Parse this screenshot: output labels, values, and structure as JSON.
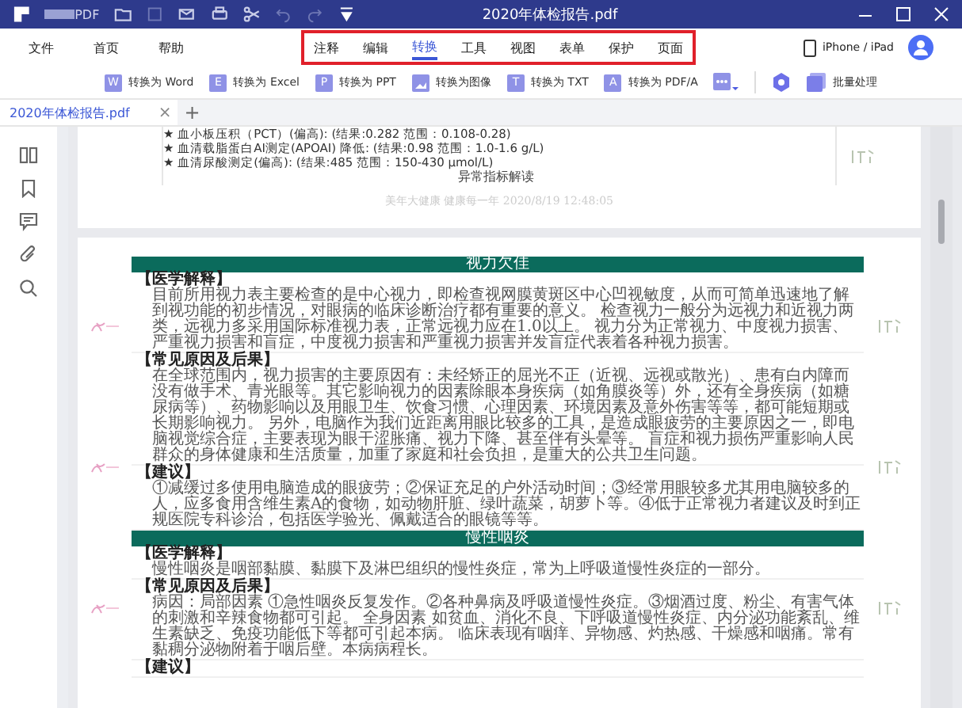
{
  "title_bar": {
    "app_name": "PDF",
    "title": "2020年体检报告.pdf"
  },
  "menu": {
    "items": [
      "文件",
      "首页",
      "帮助"
    ],
    "tabs": [
      {
        "label": "注释",
        "selected": false
      },
      {
        "label": "编辑",
        "selected": false
      },
      {
        "label": "转换",
        "selected": true
      },
      {
        "label": "工具",
        "selected": false
      },
      {
        "label": "视图",
        "selected": false
      },
      {
        "label": "表单",
        "selected": false
      },
      {
        "label": "保护",
        "selected": false
      },
      {
        "label": "页面",
        "selected": false
      }
    ],
    "device": "iPhone / iPad"
  },
  "toolbar": [
    {
      "kind": "convert",
      "icon_letter": "W",
      "label": "转换为 Word"
    },
    {
      "kind": "convert",
      "icon_letter": "E",
      "label": "转换为 Excel"
    },
    {
      "kind": "convert",
      "icon_letter": "P",
      "label": "转换为 PPT"
    },
    {
      "kind": "image",
      "label": "转换为图像"
    },
    {
      "kind": "convert",
      "icon_letter": "T",
      "label": "转换为 TXT"
    },
    {
      "kind": "convert",
      "icon_letter": "A",
      "label": "转换为 PDF/A"
    },
    {
      "kind": "more"
    },
    {
      "kind": "divider"
    },
    {
      "kind": "settings"
    },
    {
      "kind": "batch",
      "label": "批量处理"
    }
  ],
  "doc_tabs": [
    {
      "label": "2020年体检报告.pdf",
      "selected": true,
      "close": "×"
    }
  ],
  "new_tab": "+",
  "page_1": {
    "lines": [
      "★ 血小板压积（PCT）(偏高): (结果:0.282 范围：0.108-0.28)",
      "★ 血清载脂蛋白AⅠ测定(APOAⅠ) 降低: (结果:0.98 范围：1.0-1.6 g/L)",
      "★ 血清尿酸测定(偏高): (结果:485 范围：150-430 μmol/L)"
    ],
    "heading": "异常指标解读",
    "footer": "美年大健康 健康每一年 2020/8/19 12:48:05"
  },
  "page_2": {
    "sections": [
      {
        "title": "视力欠佳",
        "blocks": [
          {
            "heading": "【医学解释】",
            "text": "目前所用视力表主要检查的是中心视力，即检查视网膜黄斑区中心凹视敏度，从而可简单迅速地了解到视功能的初步情况，对眼病的临床诊断治疗都有重要的意义。 检查视力一般分为远视力和近视力两类，远视力多采用国际标准视力表，正常远视力应在1.0以上。 视力分为正常视力、中度视力损害、严重视力损害和盲症，中度视力损害和严重视力损害并发盲症代表着各种视力损害。"
          },
          {
            "heading": "【常见原因及后果】",
            "text": "在全球范围内，视力损害的主要原因有：未经矫正的屈光不正（近视、远视或散光）、患有白内障而没有做手术、青光眼等。其它影响视力的因素除眼本身疾病（如角膜炎等）外，还有全身疾病（如糖尿病等）、药物影响以及用眼卫生、饮食习惯、心理因素、环境因素及意外伤害等等，都可能短期或长期影响视力。 另外，电脑作为我们近距离用眼比较多的工具，是造成眼疲劳的主要原因之一，即电脑视觉综合症，主要表现为眼干涩胀痛、视力下降、甚至伴有头晕等。 盲症和视力损伤严重影响人民群众的身体健康和生活质量，加重了家庭和社会负担，是重大的公共卫生问题。"
          },
          {
            "heading": "【建议】",
            "text": "①减缓过多使用电脑造成的眼疲劳；②保证充足的户外活动时间；③经常用眼较多尤其用电脑较多的人，应多食用含维生素A的食物，如动物肝脏、绿叶蔬菜，胡萝卜等。④低于正常视力者建议及时到正规医院专科诊治，包括医学验光、佩戴适合的眼镜等等。"
          }
        ]
      },
      {
        "title": "慢性咽炎",
        "blocks": [
          {
            "heading": "【医学解释】",
            "text": "慢性咽炎是咽部黏膜、黏膜下及淋巴组织的慢性炎症，常为上呼吸道慢性炎症的一部分。"
          },
          {
            "heading": "【常见原因及后果】",
            "text": "病因：局部因素 ①急性咽炎反复发作。②各种鼻病及呼吸道慢性炎症。③烟酒过度、粉尘、有害气体的刺激和辛辣食物都可引起。 全身因素 如贫血、消化不良、下呼吸道慢性炎症、内分泌功能紊乱、维生素缺乏、免疫功能低下等都可引起本病。 临床表现有咽痒、异物感、灼热感、干燥感和咽痛。常有黏稠分泌物附着于咽后壁。本病病程长。"
          },
          {
            "heading": "【建议】"
          }
        ]
      }
    ]
  }
}
